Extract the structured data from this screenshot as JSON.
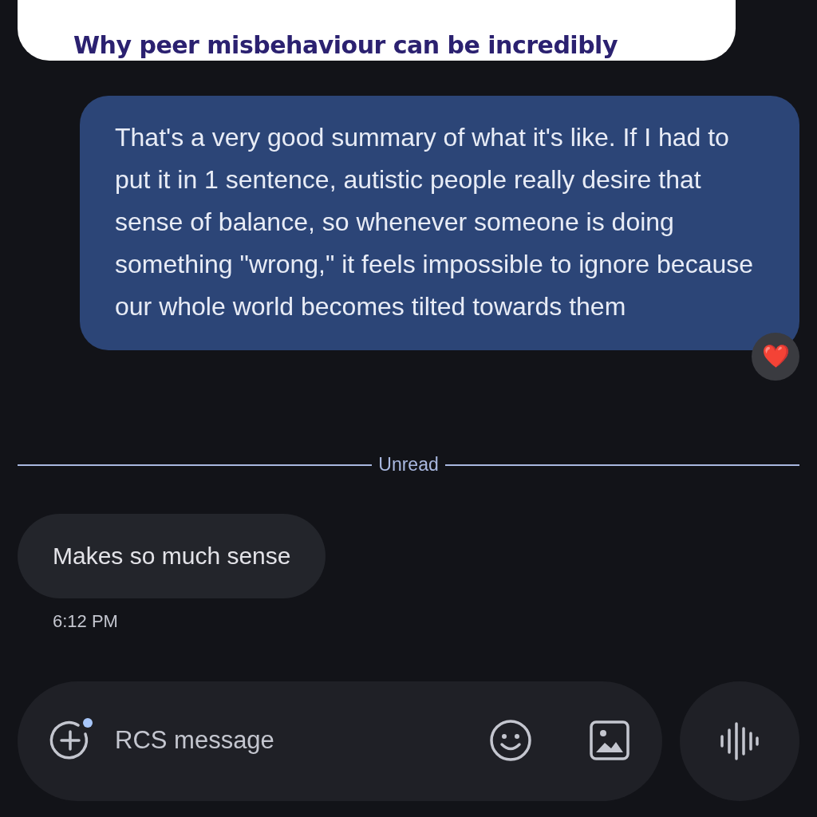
{
  "link_preview": {
    "title": "Why peer misbehaviour can be incredibly"
  },
  "messages": [
    {
      "kind": "sent",
      "text": "That's a very good summary of what it's like. If I had to put it in 1 sentence, autistic people really desire that sense of balance, so whenever someone is doing something \"wrong,\" it feels impossible to ignore because our whole world becomes tilted towards them",
      "reaction": "❤️"
    },
    {
      "kind": "divider",
      "text": "Unread"
    },
    {
      "kind": "received",
      "text": "Makes so much sense",
      "time": "6:12 PM"
    }
  ],
  "compose": {
    "placeholder": "RCS message",
    "attach_badge": true
  }
}
